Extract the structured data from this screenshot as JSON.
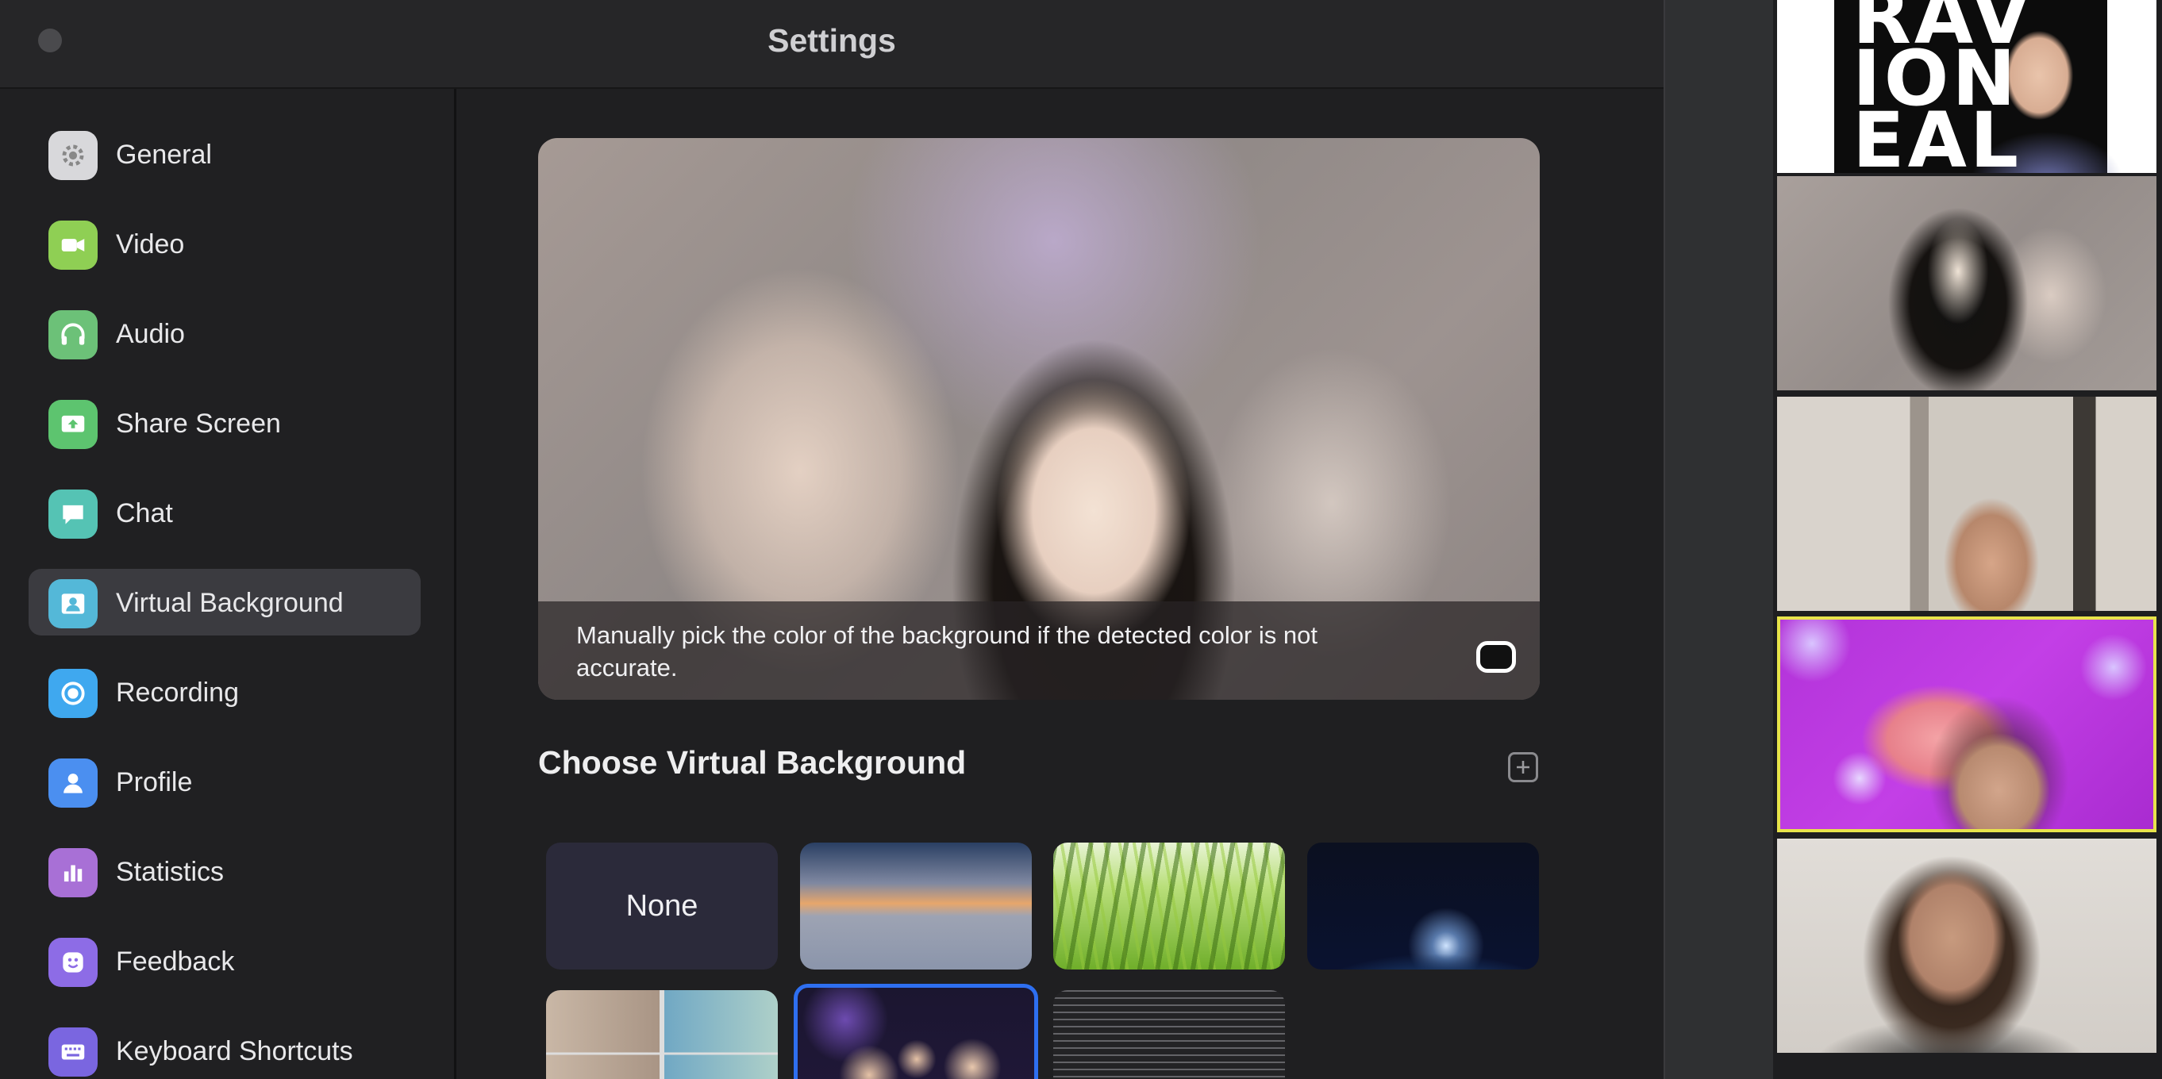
{
  "window": {
    "title": "Settings"
  },
  "sidebar": {
    "items": [
      {
        "label": "General",
        "icon": "gear-icon",
        "color": "#d8d8db",
        "selected": false
      },
      {
        "label": "Video",
        "icon": "video-camera-icon",
        "color": "#8fcf54",
        "selected": false
      },
      {
        "label": "Audio",
        "icon": "headphones-icon",
        "color": "#6cc178",
        "selected": false
      },
      {
        "label": "Share Screen",
        "icon": "share-screen-icon",
        "color": "#5dc46f",
        "selected": false
      },
      {
        "label": "Chat",
        "icon": "chat-bubble-icon",
        "color": "#55c3b4",
        "selected": false
      },
      {
        "label": "Virtual Background",
        "icon": "person-portrait-icon",
        "color": "#54b8d8",
        "selected": true
      },
      {
        "label": "Recording",
        "icon": "record-icon",
        "color": "#3fa8ef",
        "selected": false
      },
      {
        "label": "Profile",
        "icon": "profile-icon",
        "color": "#4b8ff0",
        "selected": false
      },
      {
        "label": "Statistics",
        "icon": "bar-chart-icon",
        "color": "#a870d6",
        "selected": false
      },
      {
        "label": "Feedback",
        "icon": "smiley-icon",
        "color": "#8d6ce6",
        "selected": false
      },
      {
        "label": "Keyboard Shortcuts",
        "icon": "keyboard-icon",
        "color": "#7a66e0",
        "selected": false
      }
    ]
  },
  "preview": {
    "caption": "Manually pick the color of the background if the detected color is not accurate."
  },
  "choose": {
    "title": "Choose Virtual Background",
    "tiles": [
      {
        "label": "None",
        "selected": false
      },
      {
        "label": "",
        "selected": false
      },
      {
        "label": "",
        "selected": false
      },
      {
        "label": "",
        "selected": false
      },
      {
        "label": "",
        "selected": false
      },
      {
        "label": "",
        "selected": true
      },
      {
        "label": "",
        "selected": false
      }
    ]
  },
  "participants": {
    "tiles": [
      {
        "overlay_text": "RAV\nION\nEAL",
        "active": false
      },
      {
        "overlay_text": "",
        "active": false
      },
      {
        "overlay_text": "",
        "active": false
      },
      {
        "overlay_text": "",
        "active": true
      },
      {
        "overlay_text": "",
        "active": false
      }
    ]
  },
  "colors": {
    "selected_tile_border": "#2e6ff0",
    "active_speaker_border": "#e8e34b",
    "sidebar_selected_bg": "#3b3b40"
  }
}
